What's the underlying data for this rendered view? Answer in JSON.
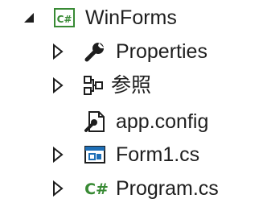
{
  "solution_explorer": {
    "project": {
      "label": "WinForms",
      "icon": "csharp-project-icon",
      "expanded": true,
      "children": [
        {
          "label": "Properties",
          "icon": "wrench-icon",
          "expander": "collapsed"
        },
        {
          "label": "参照",
          "icon": "references-icon",
          "expander": "collapsed"
        },
        {
          "label": "app.config",
          "icon": "config-file-icon",
          "expander": "none"
        },
        {
          "label": "Form1.cs",
          "icon": "form-icon",
          "expander": "collapsed"
        },
        {
          "label": "Program.cs",
          "icon": "csharp-file-icon",
          "expander": "collapsed"
        }
      ]
    }
  },
  "colors": {
    "text": "#1e1e1e",
    "csharp_green": "#388a34",
    "form_blue": "#1e6fb7"
  }
}
